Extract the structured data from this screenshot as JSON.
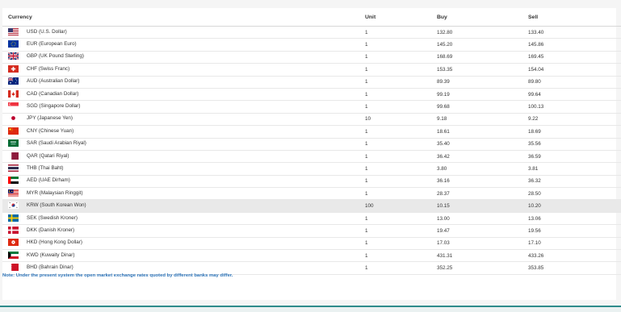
{
  "table": {
    "headers": {
      "currency": "Currency",
      "unit": "Unit",
      "buy": "Buy",
      "sell": "Sell"
    },
    "rows": [
      {
        "flag": "us-flag-icon",
        "currency": "USD (U.S. Dollar)",
        "unit": "1",
        "buy": "132.80",
        "sell": "133.40"
      },
      {
        "flag": "eu-flag-icon",
        "currency": "EUR (European Euro)",
        "unit": "1",
        "buy": "145.20",
        "sell": "145.86"
      },
      {
        "flag": "gb-flag-icon",
        "currency": "GBP (UK Pound Sterling)",
        "unit": "1",
        "buy": "168.69",
        "sell": "169.45"
      },
      {
        "flag": "ch-flag-icon",
        "currency": "CHF (Swiss Franc)",
        "unit": "1",
        "buy": "153.35",
        "sell": "154.04"
      },
      {
        "flag": "au-flag-icon",
        "currency": "AUD (Australian Dollar)",
        "unit": "1",
        "buy": "89.39",
        "sell": "89.80"
      },
      {
        "flag": "ca-flag-icon",
        "currency": "CAD (Canadian Dollar)",
        "unit": "1",
        "buy": "99.19",
        "sell": "99.64"
      },
      {
        "flag": "sg-flag-icon",
        "currency": "SGD (Singapore Dollar)",
        "unit": "1",
        "buy": "99.68",
        "sell": "100.13"
      },
      {
        "flag": "jp-flag-icon",
        "currency": "JPY (Japanese Yen)",
        "unit": "10",
        "buy": "9.18",
        "sell": "9.22"
      },
      {
        "flag": "cn-flag-icon",
        "currency": "CNY (Chinese Yuan)",
        "unit": "1",
        "buy": "18.61",
        "sell": "18.69"
      },
      {
        "flag": "sa-flag-icon",
        "currency": "SAR (Saudi Arabian Riyal)",
        "unit": "1",
        "buy": "35.40",
        "sell": "35.56"
      },
      {
        "flag": "qa-flag-icon",
        "currency": "QAR (Qatari Riyal)",
        "unit": "1",
        "buy": "36.42",
        "sell": "36.59"
      },
      {
        "flag": "th-flag-icon",
        "currency": "THB (Thai Baht)",
        "unit": "1",
        "buy": "3.80",
        "sell": "3.81"
      },
      {
        "flag": "ae-flag-icon",
        "currency": "AED (UAE Dirham)",
        "unit": "1",
        "buy": "36.16",
        "sell": "36.32"
      },
      {
        "flag": "my-flag-icon",
        "currency": "MYR (Malaysian Ringgit)",
        "unit": "1",
        "buy": "28.37",
        "sell": "28.50"
      },
      {
        "flag": "kr-flag-icon",
        "currency": "KRW (South Korean Won)",
        "unit": "100",
        "buy": "10.15",
        "sell": "10.20",
        "highlighted": true
      },
      {
        "flag": "se-flag-icon",
        "currency": "SEK (Swedish Kroner)",
        "unit": "1",
        "buy": "13.00",
        "sell": "13.06"
      },
      {
        "flag": "dk-flag-icon",
        "currency": "DKK (Danish Kroner)",
        "unit": "1",
        "buy": "19.47",
        "sell": "19.56"
      },
      {
        "flag": "hk-flag-icon",
        "currency": "HKD (Hong Kong Dollar)",
        "unit": "1",
        "buy": "17.03",
        "sell": "17.10"
      },
      {
        "flag": "kw-flag-icon",
        "currency": "KWD (Kuwaity Dinar)",
        "unit": "1",
        "buy": "431.31",
        "sell": "433.26"
      },
      {
        "flag": "bh-flag-icon",
        "currency": "BHD (Bahrain Dinar)",
        "unit": "1",
        "buy": "352.25",
        "sell": "353.85"
      }
    ]
  },
  "note": "Note: Under the present system the open market exchange rates quoted by different banks may differ.",
  "colors": {
    "note": "#2c73b8",
    "footer_accent": "#2e8b8b",
    "row_highlight": "#e9e9e9"
  }
}
